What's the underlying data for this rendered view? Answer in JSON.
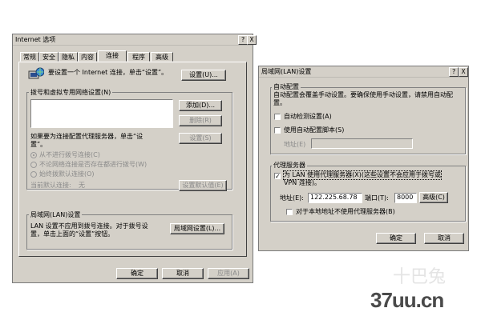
{
  "internet_options": {
    "title": "Internet 选项",
    "title_help": "?",
    "title_close": "X",
    "tabs": [
      "常规",
      "安全",
      "隐私",
      "内容",
      "连接",
      "程序",
      "高级"
    ],
    "active_tab": "连接",
    "setup_text": "要设置一个 Internet 连接，单击“设置”。",
    "setup_button": "设置(U)...",
    "dialup_group": "拨号和虚拟专用网络设置(N)",
    "add_button": "添加(D)...",
    "remove_button": "删除(R)",
    "settings_button": "设置(S)",
    "proxy_text_1": "如果要为连接配置代理服务器，单击“设",
    "proxy_text_2": "置”。",
    "radio_never": "从不进行拨号连接(C)",
    "radio_no_network": "不论网络连接是否存在都进行拨号(W)",
    "radio_always": "始终拨默认连接(O)",
    "current_default_label": "当前默认连接:",
    "current_default_value": "无",
    "set_default_button": "设置默认值(E)",
    "lan_group": "局域网(LAN)设置",
    "lan_text_1": "LAN 设置不应用到拨号连接。对于拨号设",
    "lan_text_2": "置，单击上面的“设置”按钮。",
    "lan_button": "局域网设置(L)...",
    "ok_button": "确定",
    "cancel_button": "取消",
    "apply_button": "应用(A)"
  },
  "lan_settings": {
    "title": "局域网(LAN)设置",
    "title_help": "?",
    "title_close": "X",
    "auto_group": "自动配置",
    "auto_desc_1": "自动配置会覆盖手动设置。要确保使用手动设置，请禁用自动配",
    "auto_desc_2": "置。",
    "auto_detect": "自动检测设置(A)",
    "use_script": "使用自动配置脚本(S)",
    "address_label": "地址(E)",
    "proxy_group": "代理服务器",
    "use_proxy_1": "为 LAN 使用代理服务器(X)(这些设置不会应用于拨号或",
    "use_proxy_2": "VPN 连接)。",
    "address_field_label": "地址(E):",
    "address_value": "122.225.68.78",
    "port_label": "端口(T):",
    "port_value": "8000",
    "advanced_button": "高级(C)",
    "bypass_local": "对于本地地址不使用代理服务器(B)",
    "ok_button": "确定",
    "cancel_button": "取消"
  },
  "watermark": {
    "top": "十巴兔",
    "bottom": "37uu.cn"
  }
}
